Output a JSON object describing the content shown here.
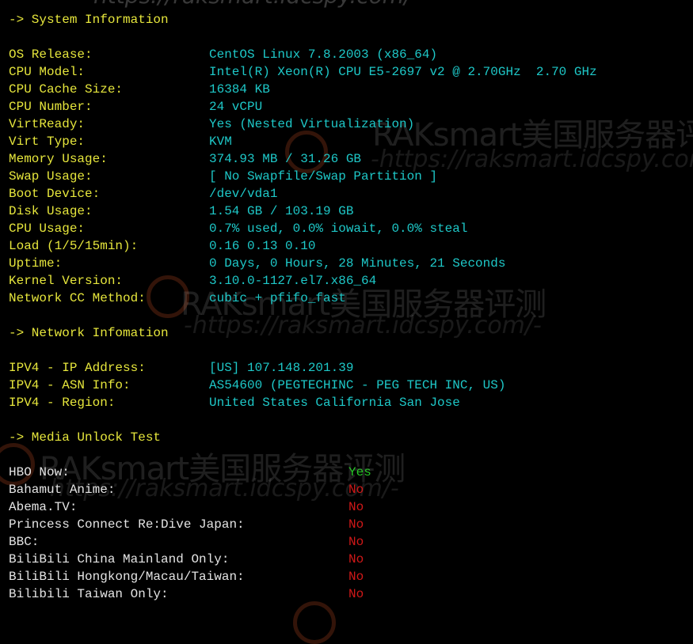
{
  "colors": {
    "background": "#000000",
    "heading": "#E6E63C",
    "value": "#1EC8C8",
    "label_media": "#E4E4E4",
    "yes": "#27C427",
    "no": "#D01818"
  },
  "top_url_fragment": "https://raksmart.idcspy.com/-",
  "sections": {
    "system": {
      "heading": "-> System Information",
      "rows": [
        {
          "label": "OS Release:",
          "value": "CentOS Linux 7.8.2003 (x86_64)"
        },
        {
          "label": "CPU Model:",
          "value": "Intel(R) Xeon(R) CPU E5-2697 v2 @ 2.70GHz  2.70 GHz"
        },
        {
          "label": "CPU Cache Size:",
          "value": "16384 KB"
        },
        {
          "label": "CPU Number:",
          "value": "24 vCPU"
        },
        {
          "label": "VirtReady:",
          "value": "Yes (Nested Virtualization)"
        },
        {
          "label": "Virt Type:",
          "value": "KVM"
        },
        {
          "label": "Memory Usage:",
          "value": "374.93 MB / 31.26 GB"
        },
        {
          "label": "Swap Usage:",
          "value": "[ No Swapfile/Swap Partition ]"
        },
        {
          "label": "Boot Device:",
          "value": "/dev/vda1"
        },
        {
          "label": "Disk Usage:",
          "value": "1.54 GB / 103.19 GB"
        },
        {
          "label": "CPU Usage:",
          "value": "0.7% used, 0.0% iowait, 0.0% steal"
        },
        {
          "label": "Load (1/5/15min):",
          "value": "0.16 0.13 0.10"
        },
        {
          "label": "Uptime:",
          "value": "0 Days, 0 Hours, 28 Minutes, 21 Seconds"
        },
        {
          "label": "Kernel Version:",
          "value": "3.10.0-1127.el7.x86_64"
        },
        {
          "label": "Network CC Method:",
          "value": "cubic + pfifo_fast"
        }
      ]
    },
    "network": {
      "heading": "-> Network Infomation",
      "rows": [
        {
          "label": "IPV4 - IP Address:",
          "value": "[US] 107.148.201.39"
        },
        {
          "label": "IPV4 - ASN Info:",
          "value": "AS54600 (PEGTECHINC - PEG TECH INC, US)"
        },
        {
          "label": "IPV4 - Region:",
          "value": "United States California San Jose"
        }
      ]
    },
    "media": {
      "heading": "-> Media Unlock Test",
      "rows": [
        {
          "label": "HBO Now:",
          "value": "Yes"
        },
        {
          "label": "Bahamut Anime:",
          "value": "No"
        },
        {
          "label": "Abema.TV:",
          "value": "No"
        },
        {
          "label": "Princess Connect Re:Dive Japan:",
          "value": "No"
        },
        {
          "label": "BBC:",
          "value": "No"
        },
        {
          "label": "BiliBili China Mainland Only:",
          "value": "No"
        },
        {
          "label": "BiliBili Hongkong/Macau/Taiwan:",
          "value": "No"
        },
        {
          "label": "Bilibili Taiwan Only:",
          "value": "No"
        }
      ]
    }
  },
  "watermarks": {
    "brand": "RAKsmart美国服务器评测",
    "url": "-https://raksmart.idcspy.com/-"
  }
}
